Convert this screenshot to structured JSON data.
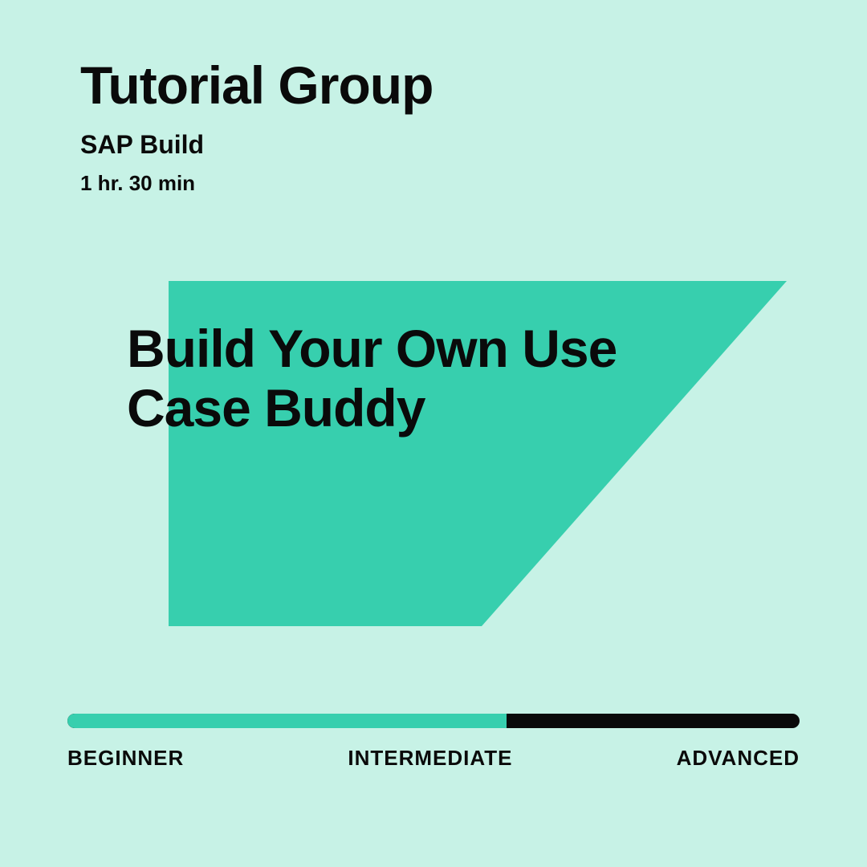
{
  "header": {
    "title": "Tutorial Group",
    "subtitle": "SAP Build",
    "duration": "1 hr. 30 min"
  },
  "course": {
    "title": "Build Your Own Use Case Buddy"
  },
  "level": {
    "labels": [
      "BEGINNER",
      "INTERMEDIATE",
      "ADVANCED"
    ],
    "fill_percent": 60
  },
  "colors": {
    "background": "#c7f2e6",
    "accent": "#37cfae",
    "text": "#0a0a0a"
  }
}
